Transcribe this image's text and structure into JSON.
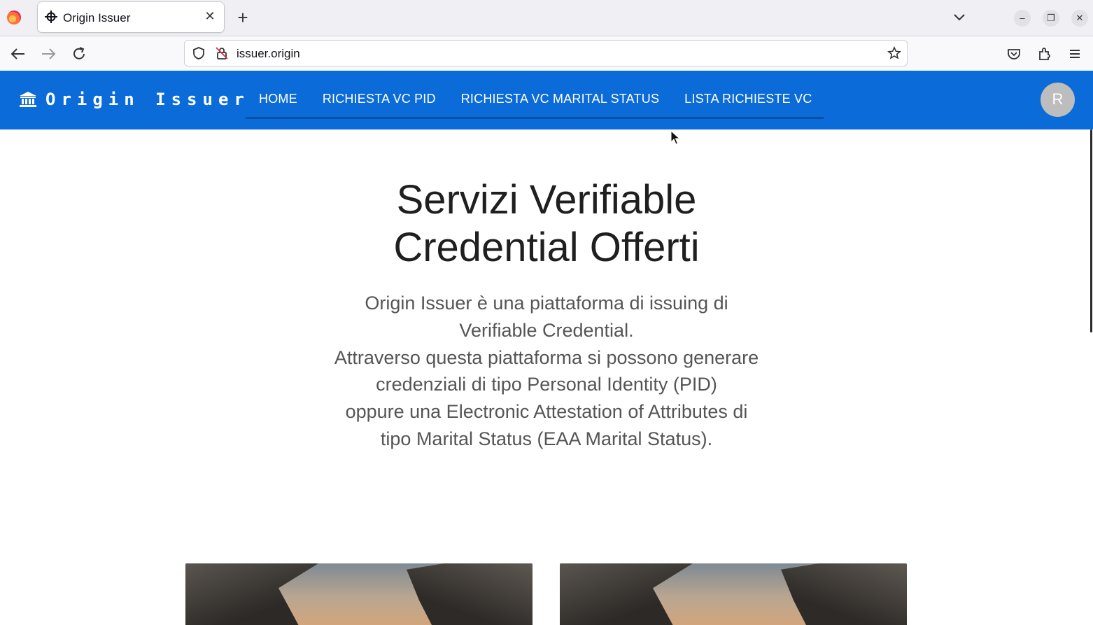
{
  "browser": {
    "tab_title": "Origin Issuer",
    "url": "issuer.origin"
  },
  "app": {
    "brand": "Origin Issuer",
    "nav": [
      {
        "label": "HOME"
      },
      {
        "label": "RICHIESTA VC PID"
      },
      {
        "label": "RICHIESTA VC MARITAL STATUS"
      },
      {
        "label": "LISTA RICHIESTE VC"
      }
    ],
    "avatar_letter": "R",
    "accent_color": "#0b6bd9"
  },
  "hero": {
    "title_line1": "Servizi Verifiable",
    "title_line2": "Credential Offerti",
    "desc_lines": [
      "Origin Issuer è una piattaforma di issuing di",
      "Verifiable Credential.",
      "Attraverso questa piattaforma si possono generare",
      "credenziali di tipo Personal Identity (PID)",
      "oppure una Electronic Attestation of Attributes di",
      "tipo Marital Status (EAA Marital Status)."
    ]
  }
}
